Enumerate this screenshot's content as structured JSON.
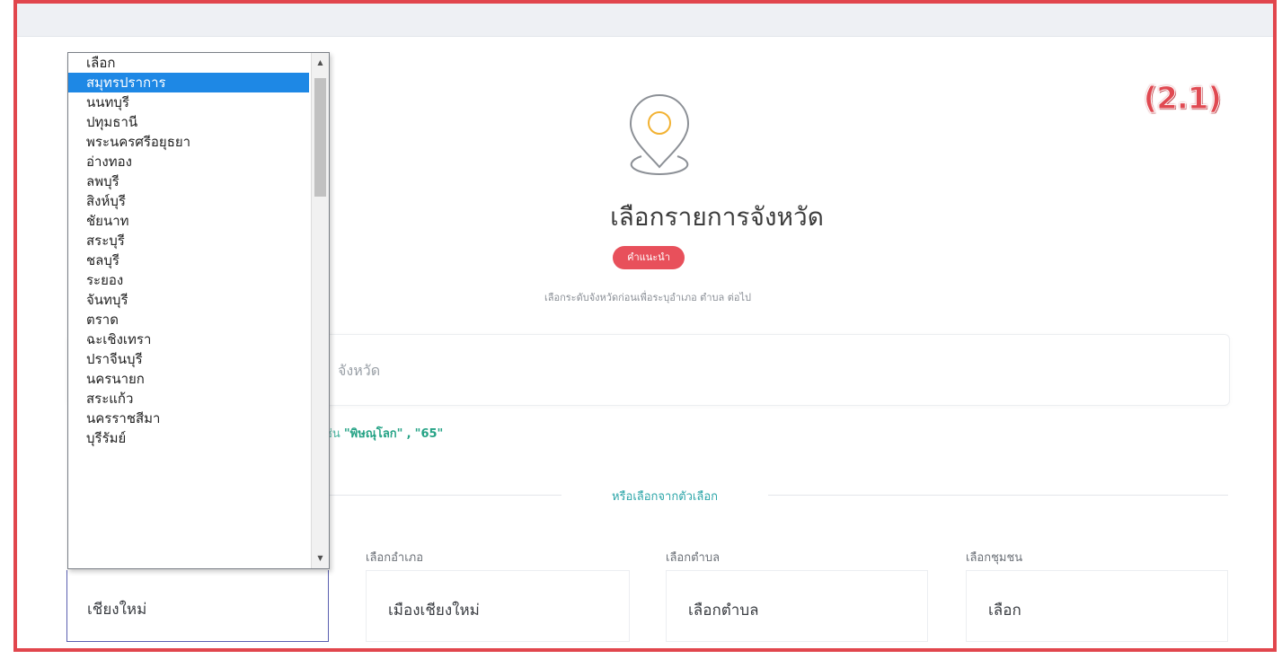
{
  "step_label": "(2.1)",
  "page_title": "เลือกรายการจังหวัด",
  "hint_badge": "คำแนะนำ",
  "subtitle": "เลือกระดับจังหวัดก่อนเพื่อระบุอำเภอ ตำบล ต่อไป",
  "search": {
    "placeholder": "จังหวัด"
  },
  "example": {
    "prefix": "ช่น",
    "value1": "\"พิษณุโลก\"",
    "separator": ",",
    "value2": "\"65\""
  },
  "or_label": "หรือเลือกจากตัวเลือก",
  "fields": {
    "district_label": "เลือกอำเภอ",
    "district_value": "เมืองเชียงใหม่",
    "subdistrict_label": "เลือกตำบล",
    "subdistrict_value": "เลือกตำบล",
    "community_label": "เลือกชุมชน",
    "community_value": "เลือก",
    "province_value": "เชียงใหม่"
  },
  "province_dropdown": {
    "selected_index": 1,
    "options": [
      "เลือก",
      "สมุทรปราการ",
      "นนทบุรี",
      "ปทุมธานี",
      "พระนครศรีอยุธยา",
      "อ่างทอง",
      "ลพบุรี",
      "สิงห์บุรี",
      "ชัยนาท",
      "สระบุรี",
      "ชลบุรี",
      "ระยอง",
      "จันทบุรี",
      "ตราด",
      "ฉะเชิงเทรา",
      "ปราจีนบุรี",
      "นครนายก",
      "สระแก้ว",
      "นครราชสีมา",
      "บุรีรัมย์"
    ]
  },
  "icons": {
    "pin": "map-pin-icon",
    "scroll_up": "▲",
    "scroll_down": "▼"
  },
  "colors": {
    "frame_border": "#e1464d",
    "accent_red": "#e8505b",
    "selected_blue": "#1e88e5",
    "teal": "#2ba5a8",
    "pin_ring": "#f2b233"
  }
}
